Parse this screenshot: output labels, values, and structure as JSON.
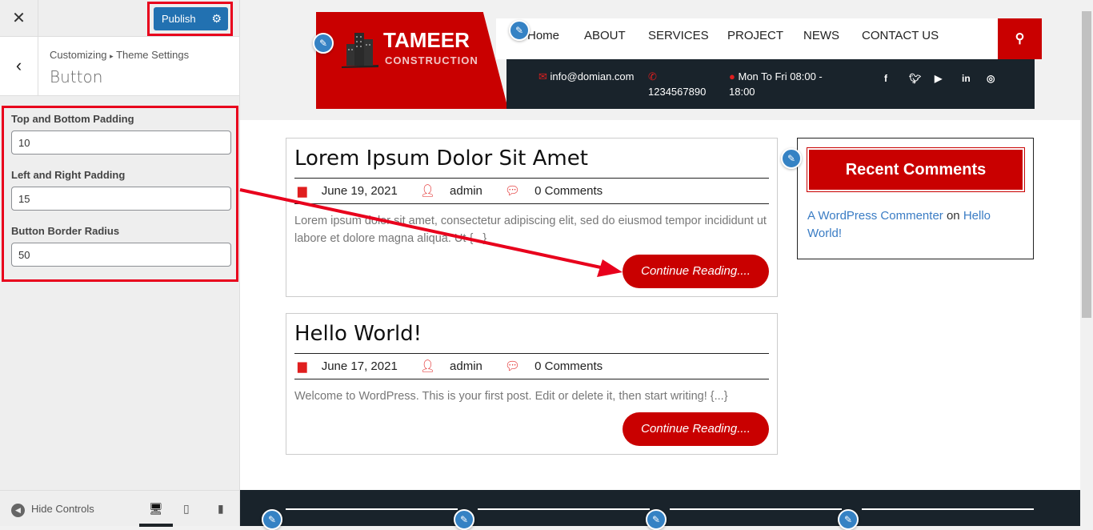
{
  "customizer": {
    "close_icon": "close-icon",
    "publish_label": "Publish",
    "breadcrumb_root": "Customizing",
    "breadcrumb_sep": "▸",
    "breadcrumb_parent": "Theme Settings",
    "section_title": "Button",
    "fields": [
      {
        "label": "Top and Bottom Padding",
        "value": "10"
      },
      {
        "label": "Left and Right Padding",
        "value": "15"
      },
      {
        "label": "Button Border Radius",
        "value": "50"
      }
    ],
    "hide_controls": "Hide Controls",
    "highlight_color": "#e8001c",
    "publish_color": "#2271b1"
  },
  "site": {
    "logo_title": "TAMEER",
    "logo_subtitle": "CONSTRUCTION",
    "nav": [
      "Home",
      "ABOUT",
      "SERVICES",
      "PROJECT",
      "NEWS",
      "CONTACT US"
    ],
    "email": "info@domian.com",
    "phone": "1234567890",
    "hours_line1": "Mon To Fri 08:00 -",
    "hours_line2": "18:00",
    "social": [
      "f",
      "t",
      "yt",
      "in",
      "ig"
    ],
    "brand_color": "#c90000",
    "dark_color": "#19232b"
  },
  "posts": [
    {
      "title": "Lorem Ipsum Dolor Sit Amet",
      "date": "June 19, 2021",
      "author": "admin",
      "comments": "0 Comments",
      "excerpt": "Lorem ipsum dolor sit amet, consectetur adipiscing elit, sed do eiusmod tempor incididunt ut labore et dolore magna aliqua. Ut {...}",
      "button": "Continue Reading...."
    },
    {
      "title": "Hello World!",
      "date": "June 17, 2021",
      "author": "admin",
      "comments": "0 Comments",
      "excerpt": "Welcome to WordPress. This is your first post. Edit or delete it, then start writing! {...}",
      "button": "Continue Reading...."
    }
  ],
  "widget": {
    "title": "Recent Comments",
    "commenter": "A WordPress Commenter",
    "on": "on",
    "post": "Hello World!"
  }
}
